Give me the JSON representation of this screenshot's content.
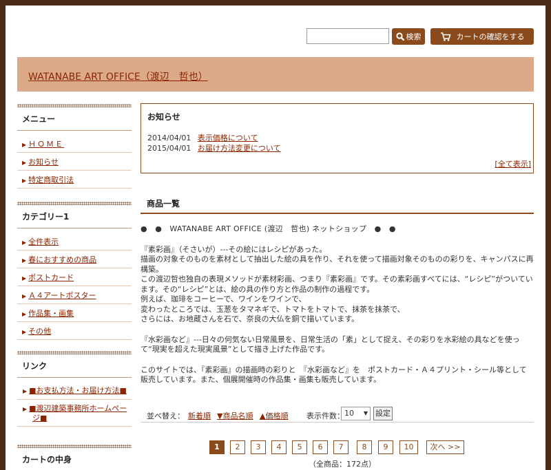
{
  "header": {
    "search_placeholder": "",
    "search_label": "検索",
    "cart_label": "カートの確認をする",
    "site_title": "WATANABE ART OFFICE（渡辺　哲也）"
  },
  "sidebar": {
    "menu": {
      "title": "メニュー",
      "items": [
        "ＨＯＭＥ",
        "お知らせ",
        "特定商取引法"
      ]
    },
    "categories": {
      "title": "カテゴリー1",
      "items": [
        "全件表示",
        "春におすすめの商品",
        "ポストカード",
        "Ａ４アートポスター",
        "作品集・画集",
        "その他"
      ]
    },
    "links": {
      "title": "リンク",
      "items": [
        "■お支払方法・お届け方法■",
        "■渡辺建築事務所ホームページ■"
      ]
    },
    "cart": {
      "title": "カートの中身"
    }
  },
  "news": {
    "title": "お知らせ",
    "items": [
      {
        "date": "2014/04/01",
        "text": "表示価格について"
      },
      {
        "date": "2015/04/01",
        "text": "お届け方法変更について"
      }
    ],
    "all_label": "[全て表示]"
  },
  "products": {
    "title": "商品一覧",
    "description": [
      "●　●　WATANABE ART OFFICE (渡辺　哲也) ネットショップ　●　●",
      "『素彩画』（そさいが）---その絵にはレシピがあった。\n描画の対象そのものを素材として抽出した絵の具を作り、それを使って描画対象そのものの彩りを、キャンパスに再構築。\nこの渡辺哲也独自の表現メソッドが素材彩画、つまり『素彩画』です。その素彩画すべてには、“レシピ”がついています。その“レシピ”とは、絵の具の作り方と作品の制作の過程です。\n例えば、珈琲をコーヒーで、ワインをワインで、\n変わったところでは、玉葱をタマネギで、トマトをトマトで、抹茶を抹茶で、\nさらには、お地蔵さんを石で、奈良の大仏を銅で描いています。",
      "『水彩画など』---日々の何気ない日常風景を、日常生活の「素」として捉え、その彩りを水彩絵の具などを使って“現実を超えた現実風景”として描き上げた作品です。",
      "このサイトでは、『素彩画』の描画時の彩りと　『水彩画など』を　ポストカード・Ａ４プリント・シール等として　販売しています。また、個展開催時の作品集・画集も販売しています。"
    ],
    "sort_label": "並べ替え：",
    "sort_options": [
      "新着順",
      "▼商品名順",
      "▲価格順"
    ],
    "count_label": "表示件数：",
    "count_value": "10",
    "set_label": "設定",
    "pages": [
      "1",
      "2",
      "3",
      "4",
      "5",
      "6",
      "7",
      "8",
      "9",
      "10"
    ],
    "next_label": "次へ >>",
    "total": "（全商品：172点）"
  }
}
